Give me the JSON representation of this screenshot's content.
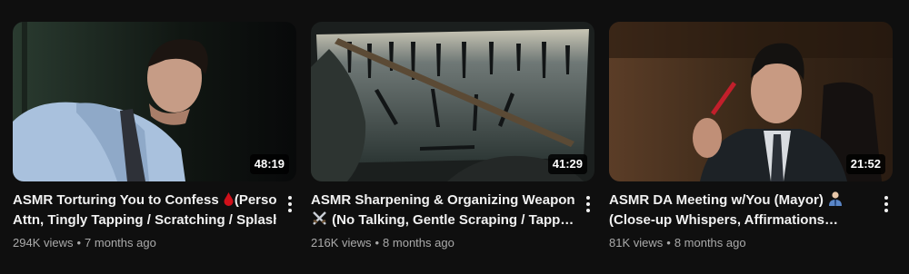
{
  "videos": [
    {
      "title_line1": "ASMR Torturing You to Confess",
      "title_line1_rest": "(Personal",
      "title_line2": "Attn, Tingly Tapping / Scratching / Splash…",
      "duration": "48:19",
      "views": "294K views",
      "age": "7 months ago",
      "emoji": "blood-drop-icon"
    },
    {
      "title_line1": "ASMR Sharpening & Organizing Weapons",
      "title_line2": "(No Talking, Gentle Scraping / Tapp…",
      "duration": "41:29",
      "views": "216K views",
      "age": "8 months ago",
      "emoji": "crossed-swords-icon"
    },
    {
      "title_line1": "ASMR DA Meeting w/You (Mayor)",
      "title_line2": "(Close-up Whispers, Affirmations…",
      "duration": "21:52",
      "views": "81K views",
      "age": "8 months ago",
      "emoji": "office-worker-icon"
    }
  ],
  "separator": "•",
  "colors": {
    "background": "#0f0f0f",
    "title": "#f1f1f1",
    "meta": "#aaaaaa",
    "drop": "#d0101a"
  }
}
